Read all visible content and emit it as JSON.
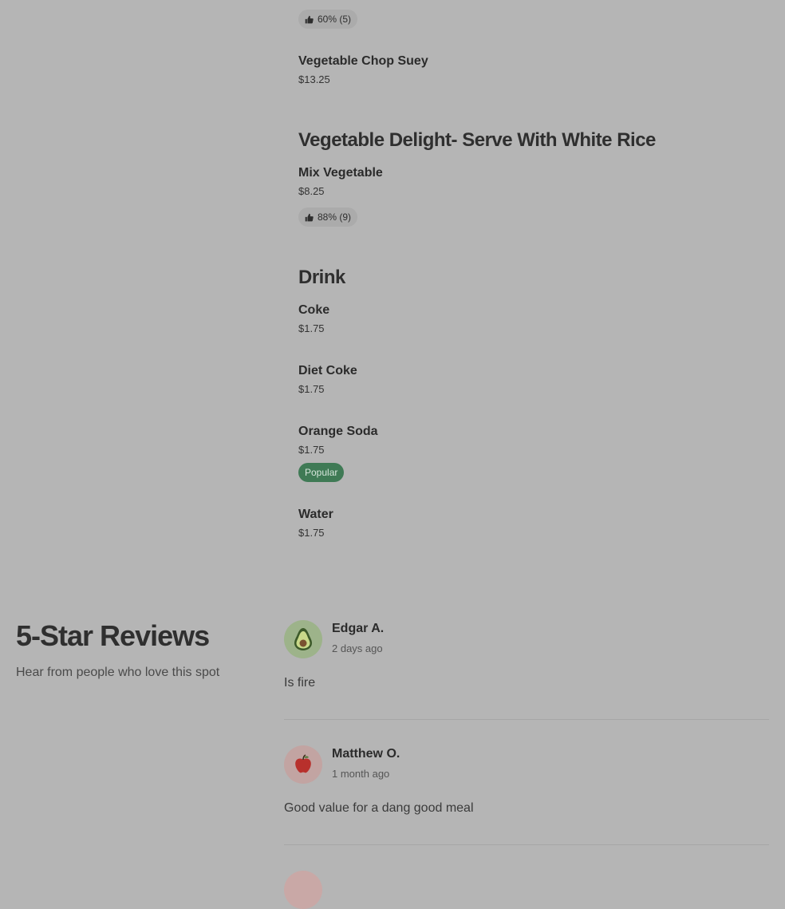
{
  "menu": {
    "cut_item_price": "$13.25",
    "items": [
      {
        "name": "",
        "price": "$13.25",
        "like": "60% (5)"
      },
      {
        "name": "Vegetable Chop Suey",
        "price": "$13.25"
      }
    ],
    "sections": [
      {
        "title": "Vegetable Delight- Serve With White Rice",
        "items": [
          {
            "name": "Mix Vegetable",
            "price": "$8.25",
            "like": "88% (9)"
          }
        ]
      },
      {
        "title": "Drink",
        "items": [
          {
            "name": "Coke",
            "price": "$1.75"
          },
          {
            "name": "Diet Coke",
            "price": "$1.75"
          },
          {
            "name": "Orange Soda",
            "price": "$1.75",
            "badge": "Popular"
          },
          {
            "name": "Water",
            "price": "$1.75"
          }
        ]
      }
    ]
  },
  "reviews": {
    "title": "5-Star Reviews",
    "subtitle": "Hear from people who love this spot",
    "list": [
      {
        "name": "Edgar A.",
        "date": "2 days ago",
        "text": "Is fire",
        "avatar_icon": "avocado-icon",
        "avatar_color": "#9db38a"
      },
      {
        "name": "Matthew O.",
        "date": "1 month ago",
        "text": "Good value for a dang good meal",
        "avatar_icon": "apple-icon",
        "avatar_color": "#c2a4a2"
      },
      {
        "name": "",
        "date": "",
        "text": "",
        "avatar_icon": "",
        "avatar_color": "#c9a8a6"
      }
    ]
  },
  "colors": {
    "background": "#b5b5b5",
    "like_badge": "#ababab",
    "popular_badge": "#3f7a55"
  }
}
